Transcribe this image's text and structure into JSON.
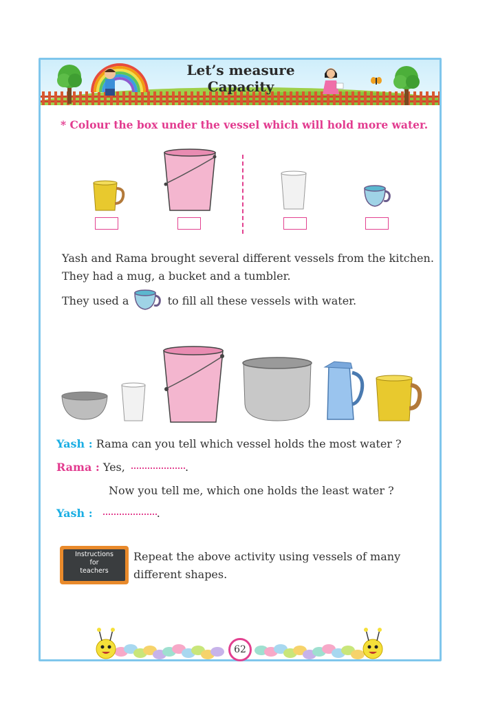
{
  "title": {
    "line1": "Let’s measure",
    "line2": "Capacity"
  },
  "instruction": "* Colour the box under the vessel which will hold more water.",
  "paragraphs": {
    "p1": "Yash and Rama brought several different vessels from the kitchen.",
    "p2": "They had a mug, a bucket and a tumbler.",
    "p3_before": "They used a",
    "p3_after": "to fill all these vessels with water."
  },
  "dialogue": {
    "yash_label": "Yash :",
    "yash_q": "Rama can you tell which vessel holds the most water ?",
    "rama_label": "Rama :",
    "rama_reply": "Yes,",
    "rama_end": ".",
    "rama_q": "Now you tell me, which one holds the least water ?",
    "yash_label2": "Yash :",
    "yash_end": "."
  },
  "teacher_board": {
    "line1": "Instructions",
    "line2": "for",
    "line3": "teachers"
  },
  "teacher_note": {
    "line1": "Repeat the above activity using vessels of many",
    "line2": "different shapes."
  },
  "page_number": "62",
  "colors": {
    "border": "#7fc6ec",
    "pink": "#e23b8f",
    "blue": "#1aaee3"
  }
}
